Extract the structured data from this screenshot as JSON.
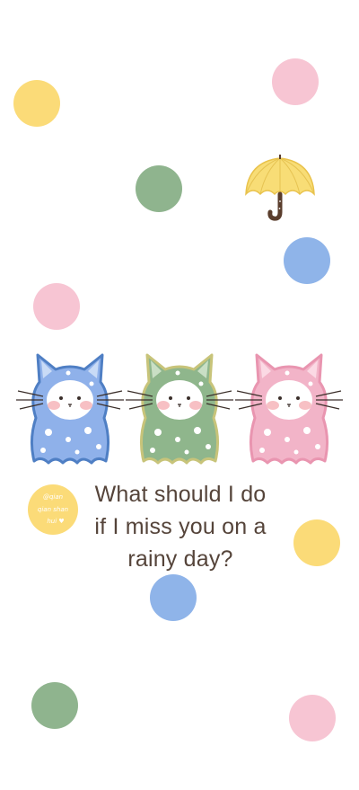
{
  "colors": {
    "yellow": "#fbdb78",
    "pink": "#f7c5d3",
    "green": "#8fb48e",
    "blue": "#8fb4e9",
    "text": "#55443a",
    "cat_blue": "#8fb1ea",
    "cat_green": "#8fb68c",
    "cat_pink": "#f2b4c8"
  },
  "dots": [
    {
      "name": "yellow-dot-top-left",
      "color": "yellow"
    },
    {
      "name": "pink-dot-top-right",
      "color": "pink"
    },
    {
      "name": "green-dot-upper-middle",
      "color": "green"
    },
    {
      "name": "blue-dot-right",
      "color": "blue"
    },
    {
      "name": "pink-dot-left",
      "color": "pink"
    },
    {
      "name": "yellow-dot-right",
      "color": "yellow"
    },
    {
      "name": "blue-dot-center",
      "color": "blue"
    },
    {
      "name": "green-dot-bottom-left",
      "color": "green"
    },
    {
      "name": "pink-dot-bottom-right",
      "color": "pink"
    }
  ],
  "message": {
    "line1": "What should I do",
    "line2": "if I miss you on a",
    "line3": "rainy day?"
  },
  "signature": {
    "line1": "@qian",
    "line2": "qian shan",
    "line3": "hui ♥"
  },
  "icons": [
    "umbrella-icon",
    "blue-cat-illustration",
    "green-cat-illustration",
    "pink-cat-illustration",
    "signature-stamp"
  ]
}
